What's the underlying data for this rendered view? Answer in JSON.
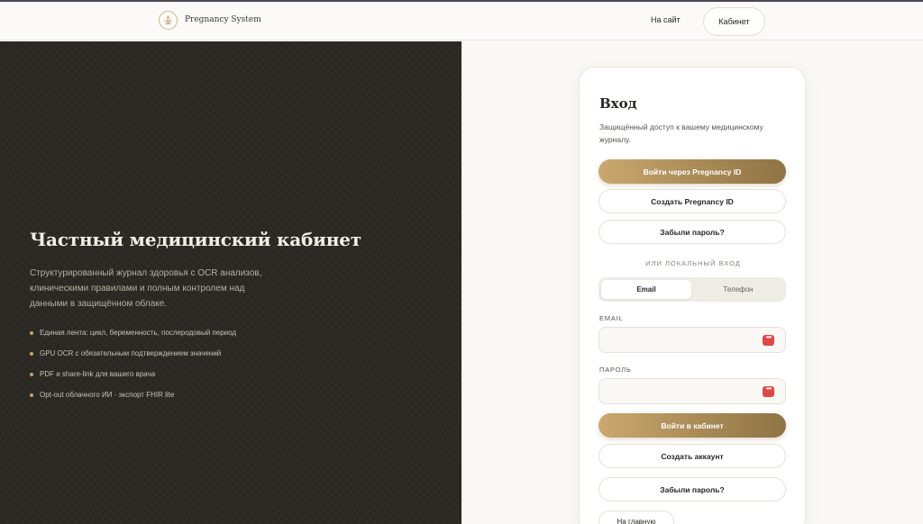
{
  "header": {
    "brand": "Pregnancy System",
    "nav_link": "На сайт",
    "cabinet_button": "Кабинет"
  },
  "hero": {
    "title": "Частный медицинский кабинет",
    "description": "Структурированный журнал здоровья с OCR анализов, клиническими правилами и полным контролем над данными в защищённом облаке.",
    "features": [
      "Единая лента: цикл, беременность, послеродовый период",
      "GPU OCR с обязательным подтверждением значений",
      "PDF и share-link для вашего врача",
      "Opt-out облачного ИИ · экспорт FHIR lite"
    ]
  },
  "login": {
    "title": "Вход",
    "subtitle": "Защищённый доступ к вашему медицинскому журналу.",
    "pregnancy_id_button": "Войти через Pregnancy ID",
    "create_id_button": "Создать Pregnancy ID",
    "forgot_password_top": "Забыли пароль?",
    "divider": "ИЛИ ЛОКАЛЬНЫЙ ВХОД",
    "tabs": [
      "Email",
      "Телефон"
    ],
    "active_tab": "Email",
    "email_label": "EMAIL",
    "email_value": "",
    "password_label": "ПАРОЛЬ",
    "password_value": "",
    "login_button": "Войти в кабинет",
    "create_account_button": "Создать аккаунт",
    "forgot_password_bottom": "Забыли пароль?",
    "bottom_button": "На главную"
  },
  "colors": {
    "accent_gold": "#b4945e",
    "hero_background": "#2c2824",
    "page_background": "#faf8f5",
    "password_manager_icon": "#e04848"
  },
  "icons": {
    "logo": "lotus-logo-icon",
    "password_field": "password-manager-icon"
  }
}
